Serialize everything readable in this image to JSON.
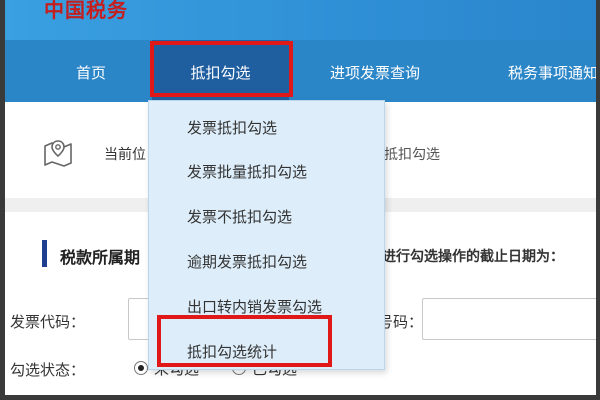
{
  "header": {
    "logo_text": "中国税务"
  },
  "nav": {
    "items": [
      {
        "label": "首页"
      },
      {
        "label": "抵扣勾选"
      },
      {
        "label": "进项发票查询"
      },
      {
        "label": "税务事项通知"
      }
    ]
  },
  "dropdown": {
    "items": [
      {
        "label": "发票抵扣勾选"
      },
      {
        "label": "发票批量抵扣勾选"
      },
      {
        "label": "发票不抵扣勾选"
      },
      {
        "label": "逾期发票抵扣勾选"
      },
      {
        "label": "出口转内销发票勾选"
      },
      {
        "label": "抵扣勾选统计"
      }
    ]
  },
  "breadcrumb": {
    "prefix": "当前位",
    "current": "抵扣勾选"
  },
  "section": {
    "title": "税款所属期",
    "deadline_text": "进行勾选操作的截止日期为："
  },
  "form": {
    "invoice_code_label": "发票代码：",
    "invoice_number_label": "号码：",
    "status_label": "勾选状态：",
    "status_options": [
      {
        "label": "未勾选",
        "checked": true
      },
      {
        "label": "已勾选",
        "checked": false
      }
    ]
  },
  "colors": {
    "nav_bg": "#2b86c8",
    "nav_active": "#1f5fa0",
    "highlight": "#e01818",
    "dropdown_bg": "#ddeefa"
  }
}
